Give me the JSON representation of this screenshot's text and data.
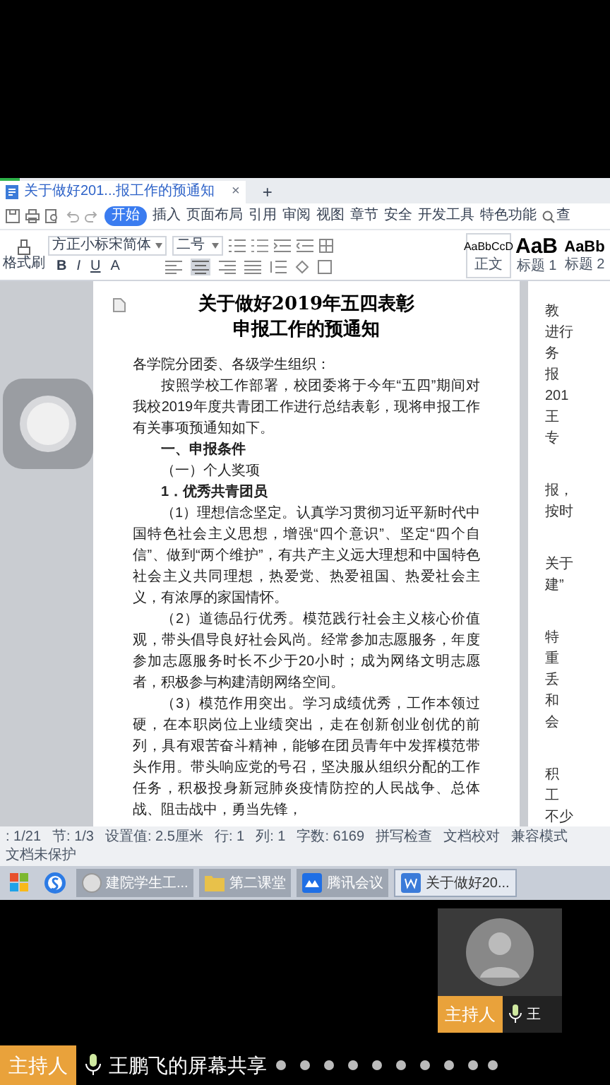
{
  "document_tab": {
    "title": "关于做好201...报工作的预通知",
    "close": "×",
    "new_tab": "+"
  },
  "menu": [
    {
      "label": "开始",
      "selected": true
    },
    {
      "label": "插入",
      "selected": false
    },
    {
      "label": "页面布局",
      "selected": false
    },
    {
      "label": "引用",
      "selected": false
    },
    {
      "label": "审阅",
      "selected": false
    },
    {
      "label": "视图",
      "selected": false
    },
    {
      "label": "章节",
      "selected": false
    },
    {
      "label": "安全",
      "selected": false
    },
    {
      "label": "开发工具",
      "selected": false
    },
    {
      "label": "特色功能",
      "selected": false
    }
  ],
  "menu_search": "查",
  "toolbar": {
    "format_painter": "格式刷",
    "font": "方正小标宋简体",
    "size": "二号",
    "format_buttons": [
      "B",
      "I",
      "U",
      "A"
    ],
    "styles": [
      {
        "kind": "normal",
        "sample": "AaBbCcD",
        "label": "正文"
      },
      {
        "kind": "heading1",
        "sample": "AaB",
        "label": "标题 1"
      },
      {
        "kind": "heading2",
        "sample": "AaBb",
        "label": "标题 2"
      }
    ]
  },
  "document": {
    "title_lines": [
      "关于做好2019年五四表彰",
      "申报工作的预通知"
    ],
    "paragraphs": [
      {
        "kind": "salutation",
        "text": "各学院分团委、各级学生组织："
      },
      {
        "kind": "body",
        "text": "按照学校工作部署，校团委将于今年“五四”期间对我校2019年度共青团工作进行总结表彰，现将申报工作有关事项预通知如下。"
      },
      {
        "kind": "heading",
        "text": "一、申报条件"
      },
      {
        "kind": "subheading",
        "text": "（一）个人奖项"
      },
      {
        "kind": "item",
        "text": "1．优秀共青团员"
      },
      {
        "kind": "body",
        "text": "（1）理想信念坚定。认真学习贯彻习近平新时代中国特色社会主义思想，增强“四个意识”、坚定“四个自信”、做到“两个维护”，有共产主义远大理想和中国特色社会主义共同理想，热爱党、热爱祖国、热爱社会主义，有浓厚的家国情怀。"
      },
      {
        "kind": "body",
        "text": "（2）道德品行优秀。模范践行社会主义核心价值观，带头倡导良好社会风尚。经常参加志愿服务，年度参加志愿服务时长不少于20小时；成为网络文明志愿者，积极参与构建清朗网络空间。"
      },
      {
        "kind": "body",
        "text": "（3）模范作用突出。学习成绩优秀，工作本领过硬，在本职岗位上业绩突出，走在创新创业创优的前列，具有艰苦奋斗精神，能够在团员青年中发挥模范带头作用。带头响应党的号召，坚决服从组织分配的工作任务，积极投身新冠肺炎疫情防控的人民战争、总体战、阻击战中，勇当先锋，"
      }
    ]
  },
  "next_page": {
    "fragment_groups": [
      [
        "教",
        "进行",
        "务",
        "报",
        "201",
        "王",
        "专"
      ],
      [
        "报，",
        "按时"
      ],
      [
        "关于",
        "建”"
      ],
      [
        "特",
        "重",
        "丢",
        "和",
        "会"
      ],
      [
        "积",
        "工",
        "不少"
      ]
    ]
  },
  "status_bar": [
    ": 1/21",
    "节: 1/3",
    "设置值: 2.5厘米",
    "行: 1",
    "列: 1",
    "字数: 6169",
    "拼写检查",
    "文档校对",
    "兼容模式",
    "文档未保护"
  ],
  "taskbar": [
    {
      "kind": "start"
    },
    {
      "kind": "sogou"
    },
    {
      "kind": "app",
      "label": "建院学生工...",
      "selected": false
    },
    {
      "kind": "folder",
      "label": "第二课堂",
      "selected": false
    },
    {
      "kind": "meeting",
      "label": "腾讯会议",
      "selected": false
    },
    {
      "kind": "wps",
      "label": "关于做好20...",
      "selected": true
    }
  ],
  "video_tile": {
    "badge": "主持人",
    "name": "王"
  },
  "share_bar": {
    "badge": "主持人",
    "title": "王鹏飞的屏幕共享"
  }
}
